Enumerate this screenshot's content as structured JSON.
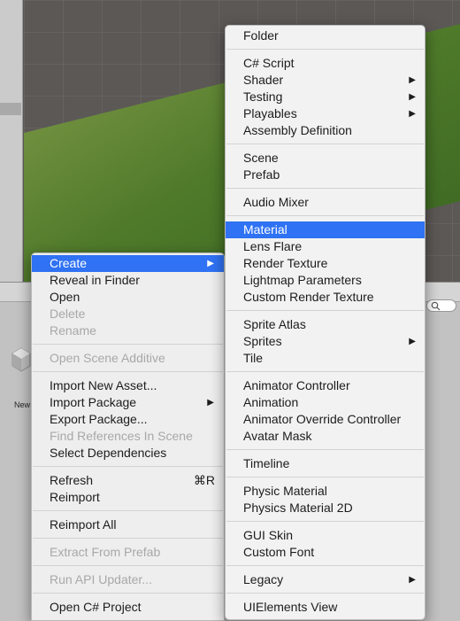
{
  "asset_label": "New",
  "context_menu": {
    "groups": [
      [
        {
          "label": "Create",
          "state": "highlighted",
          "submenu": true
        },
        {
          "label": "Reveal in Finder"
        },
        {
          "label": "Open"
        },
        {
          "label": "Delete",
          "state": "disabled"
        },
        {
          "label": "Rename",
          "state": "disabled"
        }
      ],
      [
        {
          "label": "Open Scene Additive",
          "state": "disabled"
        }
      ],
      [
        {
          "label": "Import New Asset..."
        },
        {
          "label": "Import Package",
          "submenu": true
        },
        {
          "label": "Export Package..."
        },
        {
          "label": "Find References In Scene",
          "state": "disabled"
        },
        {
          "label": "Select Dependencies"
        }
      ],
      [
        {
          "label": "Refresh",
          "shortcut": "⌘R"
        },
        {
          "label": "Reimport"
        }
      ],
      [
        {
          "label": "Reimport All"
        }
      ],
      [
        {
          "label": "Extract From Prefab",
          "state": "disabled"
        }
      ],
      [
        {
          "label": "Run API Updater...",
          "state": "disabled"
        }
      ],
      [
        {
          "label": "Open C# Project"
        }
      ]
    ]
  },
  "create_submenu": {
    "groups": [
      [
        {
          "label": "Folder"
        }
      ],
      [
        {
          "label": "C# Script"
        },
        {
          "label": "Shader",
          "submenu": true
        },
        {
          "label": "Testing",
          "submenu": true
        },
        {
          "label": "Playables",
          "submenu": true
        },
        {
          "label": "Assembly Definition"
        }
      ],
      [
        {
          "label": "Scene"
        },
        {
          "label": "Prefab"
        }
      ],
      [
        {
          "label": "Audio Mixer"
        }
      ],
      [
        {
          "label": "Material",
          "state": "highlighted"
        },
        {
          "label": "Lens Flare"
        },
        {
          "label": "Render Texture"
        },
        {
          "label": "Lightmap Parameters"
        },
        {
          "label": "Custom Render Texture"
        }
      ],
      [
        {
          "label": "Sprite Atlas"
        },
        {
          "label": "Sprites",
          "submenu": true
        },
        {
          "label": "Tile"
        }
      ],
      [
        {
          "label": "Animator Controller"
        },
        {
          "label": "Animation"
        },
        {
          "label": "Animator Override Controller"
        },
        {
          "label": "Avatar Mask"
        }
      ],
      [
        {
          "label": "Timeline"
        }
      ],
      [
        {
          "label": "Physic Material"
        },
        {
          "label": "Physics Material 2D"
        }
      ],
      [
        {
          "label": "GUI Skin"
        },
        {
          "label": "Custom Font"
        }
      ],
      [
        {
          "label": "Legacy",
          "submenu": true
        }
      ],
      [
        {
          "label": "UIElements View"
        }
      ]
    ]
  },
  "colors": {
    "highlight": "#2f72f3",
    "menu_bg": "#eeeeee",
    "disabled_text": "#a8a8a8"
  },
  "icons": {
    "submenu_arrow": "▶",
    "search": "search-icon"
  }
}
